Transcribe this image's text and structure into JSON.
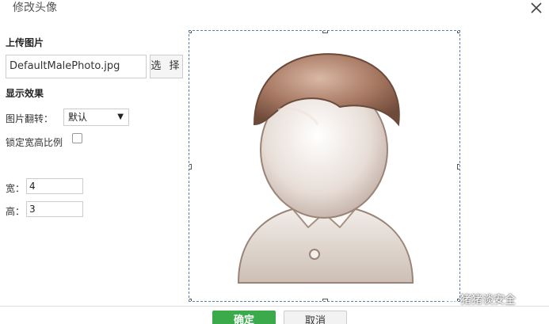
{
  "dialog": {
    "title": "修改头像",
    "close_icon": "close-icon"
  },
  "upload": {
    "section_label": "上传图片",
    "file_value": "DefaultMalePhoto.jpg",
    "select_button": "选 择"
  },
  "display": {
    "section_label": "显示效果",
    "flip_label": "图片翻转：",
    "flip_value": "默认",
    "lock_ratio_label": "锁定宽高比例",
    "lock_ratio_checked": false,
    "width_label": "宽：",
    "width_value": "4",
    "height_label": "高：",
    "height_value": "3"
  },
  "preview": {
    "image_name": "default-male-avatar"
  },
  "watermark": {
    "text": "猪猪谈安全"
  },
  "footer": {
    "ok_button": "确定",
    "cancel_button": "取消"
  },
  "colors": {
    "ok_button": "#3aaa4a",
    "crop_border": "#5a7fb0"
  }
}
